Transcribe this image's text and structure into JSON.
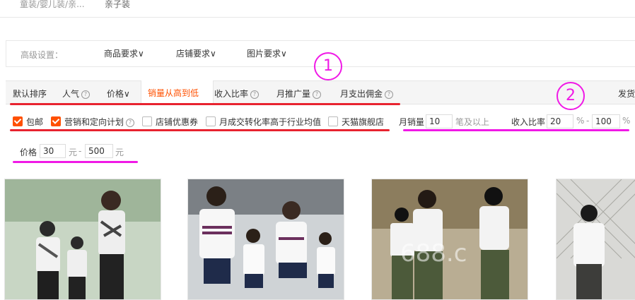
{
  "top_category": {
    "item1": "童装/婴儿装/亲...",
    "item2": "亲子装"
  },
  "advanced": {
    "label": "高级设置：",
    "product_req": "商品要求",
    "shop_req": "店铺要求",
    "image_req": "图片要求"
  },
  "sort": {
    "default": "默认排序",
    "popularity": "人气",
    "price": "价格",
    "sales_desc": "销量从高到低",
    "income_ratio": "收入比率",
    "monthly_promo": "月推广量",
    "monthly_commission": "月支出佣金",
    "ship_from": "发货"
  },
  "filters": {
    "free_shipping": {
      "label": "包邮",
      "checked": true
    },
    "marketing_plan": {
      "label": "营销和定向计划",
      "checked": true
    },
    "shop_coupon": {
      "label": "店铺优惠券",
      "checked": false
    },
    "conversion": {
      "label": "月成交转化率高于行业均值",
      "checked": false
    },
    "tmall": {
      "label": "天猫旗舰店",
      "checked": false
    },
    "monthly_sales": {
      "label": "月销量",
      "value": "10",
      "suffix": "笔及以上"
    },
    "income_ratio": {
      "label": "收入比率",
      "min": "20",
      "max": "100",
      "unit": "%",
      "sep": "-"
    },
    "price": {
      "label": "价格",
      "min": "30",
      "max": "500",
      "unit": "元",
      "sep": "-"
    }
  },
  "annotations": {
    "one": "1",
    "two": "2"
  },
  "colors": {
    "accent": "#ff5000",
    "red_mark": "#e8232f",
    "magenta_mark": "#f019e6"
  },
  "products": [
    {
      "icon": "product-image"
    },
    {
      "icon": "product-image"
    },
    {
      "icon": "product-image"
    },
    {
      "icon": "product-image"
    }
  ]
}
